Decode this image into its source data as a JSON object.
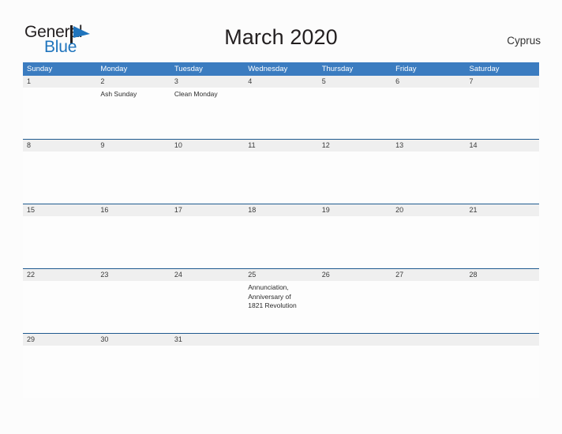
{
  "brand": {
    "name_line1": "General",
    "name_line2": "Blue",
    "flag_icon": "triangle-flag-icon",
    "color_dark": "#231f20",
    "color_blue": "#1f74bd"
  },
  "header": {
    "title": "March 2020",
    "region": "Cyprus"
  },
  "calendar": {
    "accent_header_color": "#3b7cc0",
    "row_divider_color": "#1f5a8f",
    "date_band_color": "#efefef",
    "weekdays": [
      "Sunday",
      "Monday",
      "Tuesday",
      "Wednesday",
      "Thursday",
      "Friday",
      "Saturday"
    ],
    "weeks": [
      {
        "dates": [
          "1",
          "2",
          "3",
          "4",
          "5",
          "6",
          "7"
        ],
        "events": [
          [],
          [
            "Ash Sunday"
          ],
          [
            "Clean Monday"
          ],
          [],
          [],
          [],
          []
        ]
      },
      {
        "dates": [
          "8",
          "9",
          "10",
          "11",
          "12",
          "13",
          "14"
        ],
        "events": [
          [],
          [],
          [],
          [],
          [],
          [],
          []
        ]
      },
      {
        "dates": [
          "15",
          "16",
          "17",
          "18",
          "19",
          "20",
          "21"
        ],
        "events": [
          [],
          [],
          [],
          [],
          [],
          [],
          []
        ]
      },
      {
        "dates": [
          "22",
          "23",
          "24",
          "25",
          "26",
          "27",
          "28"
        ],
        "events": [
          [],
          [],
          [],
          [
            "Annunciation,",
            "Anniversary of",
            "1821 Revolution"
          ],
          [],
          [],
          []
        ]
      },
      {
        "dates": [
          "29",
          "30",
          "31",
          "",
          "",
          "",
          ""
        ],
        "events": [
          [],
          [],
          [],
          [],
          [],
          [],
          []
        ]
      }
    ]
  }
}
